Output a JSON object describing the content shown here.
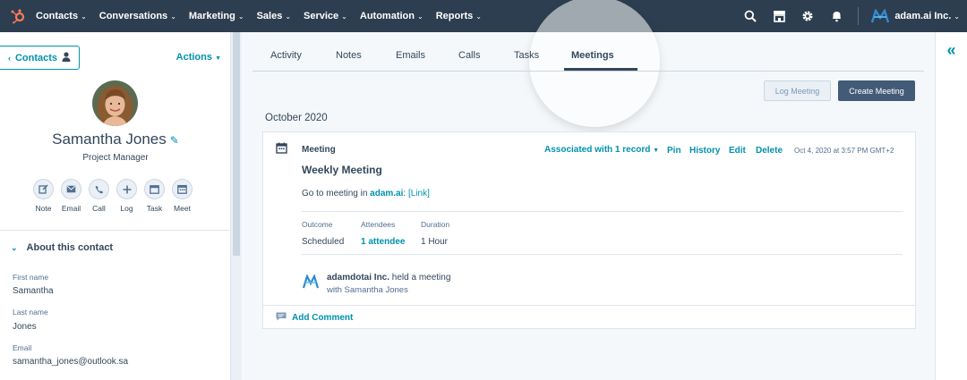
{
  "topnav": {
    "items": [
      {
        "label": "Contacts"
      },
      {
        "label": "Conversations"
      },
      {
        "label": "Marketing"
      },
      {
        "label": "Sales"
      },
      {
        "label": "Service"
      },
      {
        "label": "Automation"
      },
      {
        "label": "Reports"
      }
    ],
    "account": "adam.ai Inc."
  },
  "sidebar": {
    "back_label": "Contacts",
    "actions_label": "Actions",
    "name": "Samantha Jones",
    "title": "Project Manager",
    "quick_actions": [
      {
        "label": "Note",
        "icon": "note-icon"
      },
      {
        "label": "Email",
        "icon": "email-icon"
      },
      {
        "label": "Call",
        "icon": "phone-icon"
      },
      {
        "label": "Log",
        "icon": "plus-icon"
      },
      {
        "label": "Task",
        "icon": "task-icon"
      },
      {
        "label": "Meet",
        "icon": "calendar-icon"
      }
    ],
    "about_label": "About this contact",
    "properties": [
      {
        "label": "First name",
        "value": "Samantha"
      },
      {
        "label": "Last name",
        "value": "Jones"
      },
      {
        "label": "Email",
        "value": "samantha_jones@outlook.sa"
      }
    ]
  },
  "tabs": [
    {
      "label": "Activity"
    },
    {
      "label": "Notes"
    },
    {
      "label": "Emails"
    },
    {
      "label": "Calls"
    },
    {
      "label": "Tasks"
    },
    {
      "label": "Meetings",
      "active": true
    }
  ],
  "buttons": {
    "log": "Log Meeting",
    "create": "Create Meeting"
  },
  "timeline": {
    "month": "October 2020",
    "card": {
      "type": "Meeting",
      "associated": "Associated with 1 record",
      "actions": [
        "Pin",
        "History",
        "Edit",
        "Delete"
      ],
      "date": "Oct 4, 2020 at 3:57 PM GMT+2",
      "title": "Weekly Meeting",
      "body_prefix": "Go to meeting in ",
      "body_link": "adam.ai",
      "body_sep": ": ",
      "body_link2": "[Link]",
      "details": [
        {
          "label": "Outcome",
          "value": "Scheduled"
        },
        {
          "label": "Attendees",
          "value": "1 attendee"
        },
        {
          "label": "Duration",
          "value": "1 Hour"
        }
      ],
      "organizer": "adamdotai Inc.",
      "organizer_action": " held a meeting",
      "with_text": "with Samantha Jones",
      "add_comment": "Add Comment"
    }
  },
  "colors": {
    "nav_bg": "#2d3e50",
    "accent": "#0091ae",
    "hubspot_orange": "#ff7a59",
    "primary_button": "#425b76"
  }
}
